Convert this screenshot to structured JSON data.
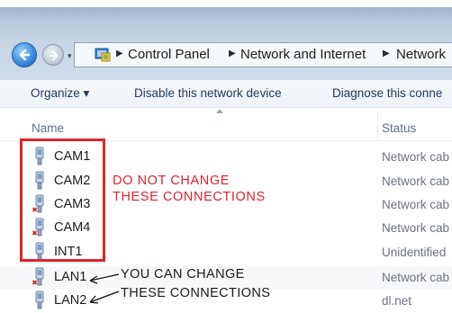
{
  "top": {
    "cut_text": "(letters cut off above)",
    "paren": "("
  },
  "address": {
    "crumbs": [
      "Control Panel",
      "Network and Internet",
      "Network"
    ]
  },
  "toolbar": {
    "organize": "Organize ▾",
    "disable": "Disable this network device",
    "diagnose": "Diagnose this conne"
  },
  "columns": {
    "name": "Name",
    "status": "Status"
  },
  "connections": [
    {
      "name": "CAM1",
      "status": "Network cab",
      "disabled": false
    },
    {
      "name": "CAM2",
      "status": "Network cab",
      "disabled": false
    },
    {
      "name": "CAM3",
      "status": "Network cab",
      "disabled": true
    },
    {
      "name": "CAM4",
      "status": "Network cab",
      "disabled": true
    },
    {
      "name": "INT1",
      "status": "Unidentified",
      "disabled": false
    },
    {
      "name": "LAN1",
      "status": "Network cab",
      "disabled": true
    },
    {
      "name": "LAN2",
      "status": "dl.net",
      "disabled": false
    }
  ],
  "annotations": {
    "do_not_1": "DO NOT CHANGE",
    "do_not_2": "THESE CONNECTIONS",
    "can_1": "YOU CAN CHANGE",
    "can_2": "THESE CONNECTIONS"
  },
  "colors": {
    "annotation_red": "#e1222a",
    "window_blue": "#b7c8dc"
  },
  "icons": [
    "back-arrow-icon",
    "forward-arrow-icon",
    "control-panel-icon",
    "network-adapter-icon",
    "disabled-x-icon",
    "sort-caret-icon"
  ]
}
